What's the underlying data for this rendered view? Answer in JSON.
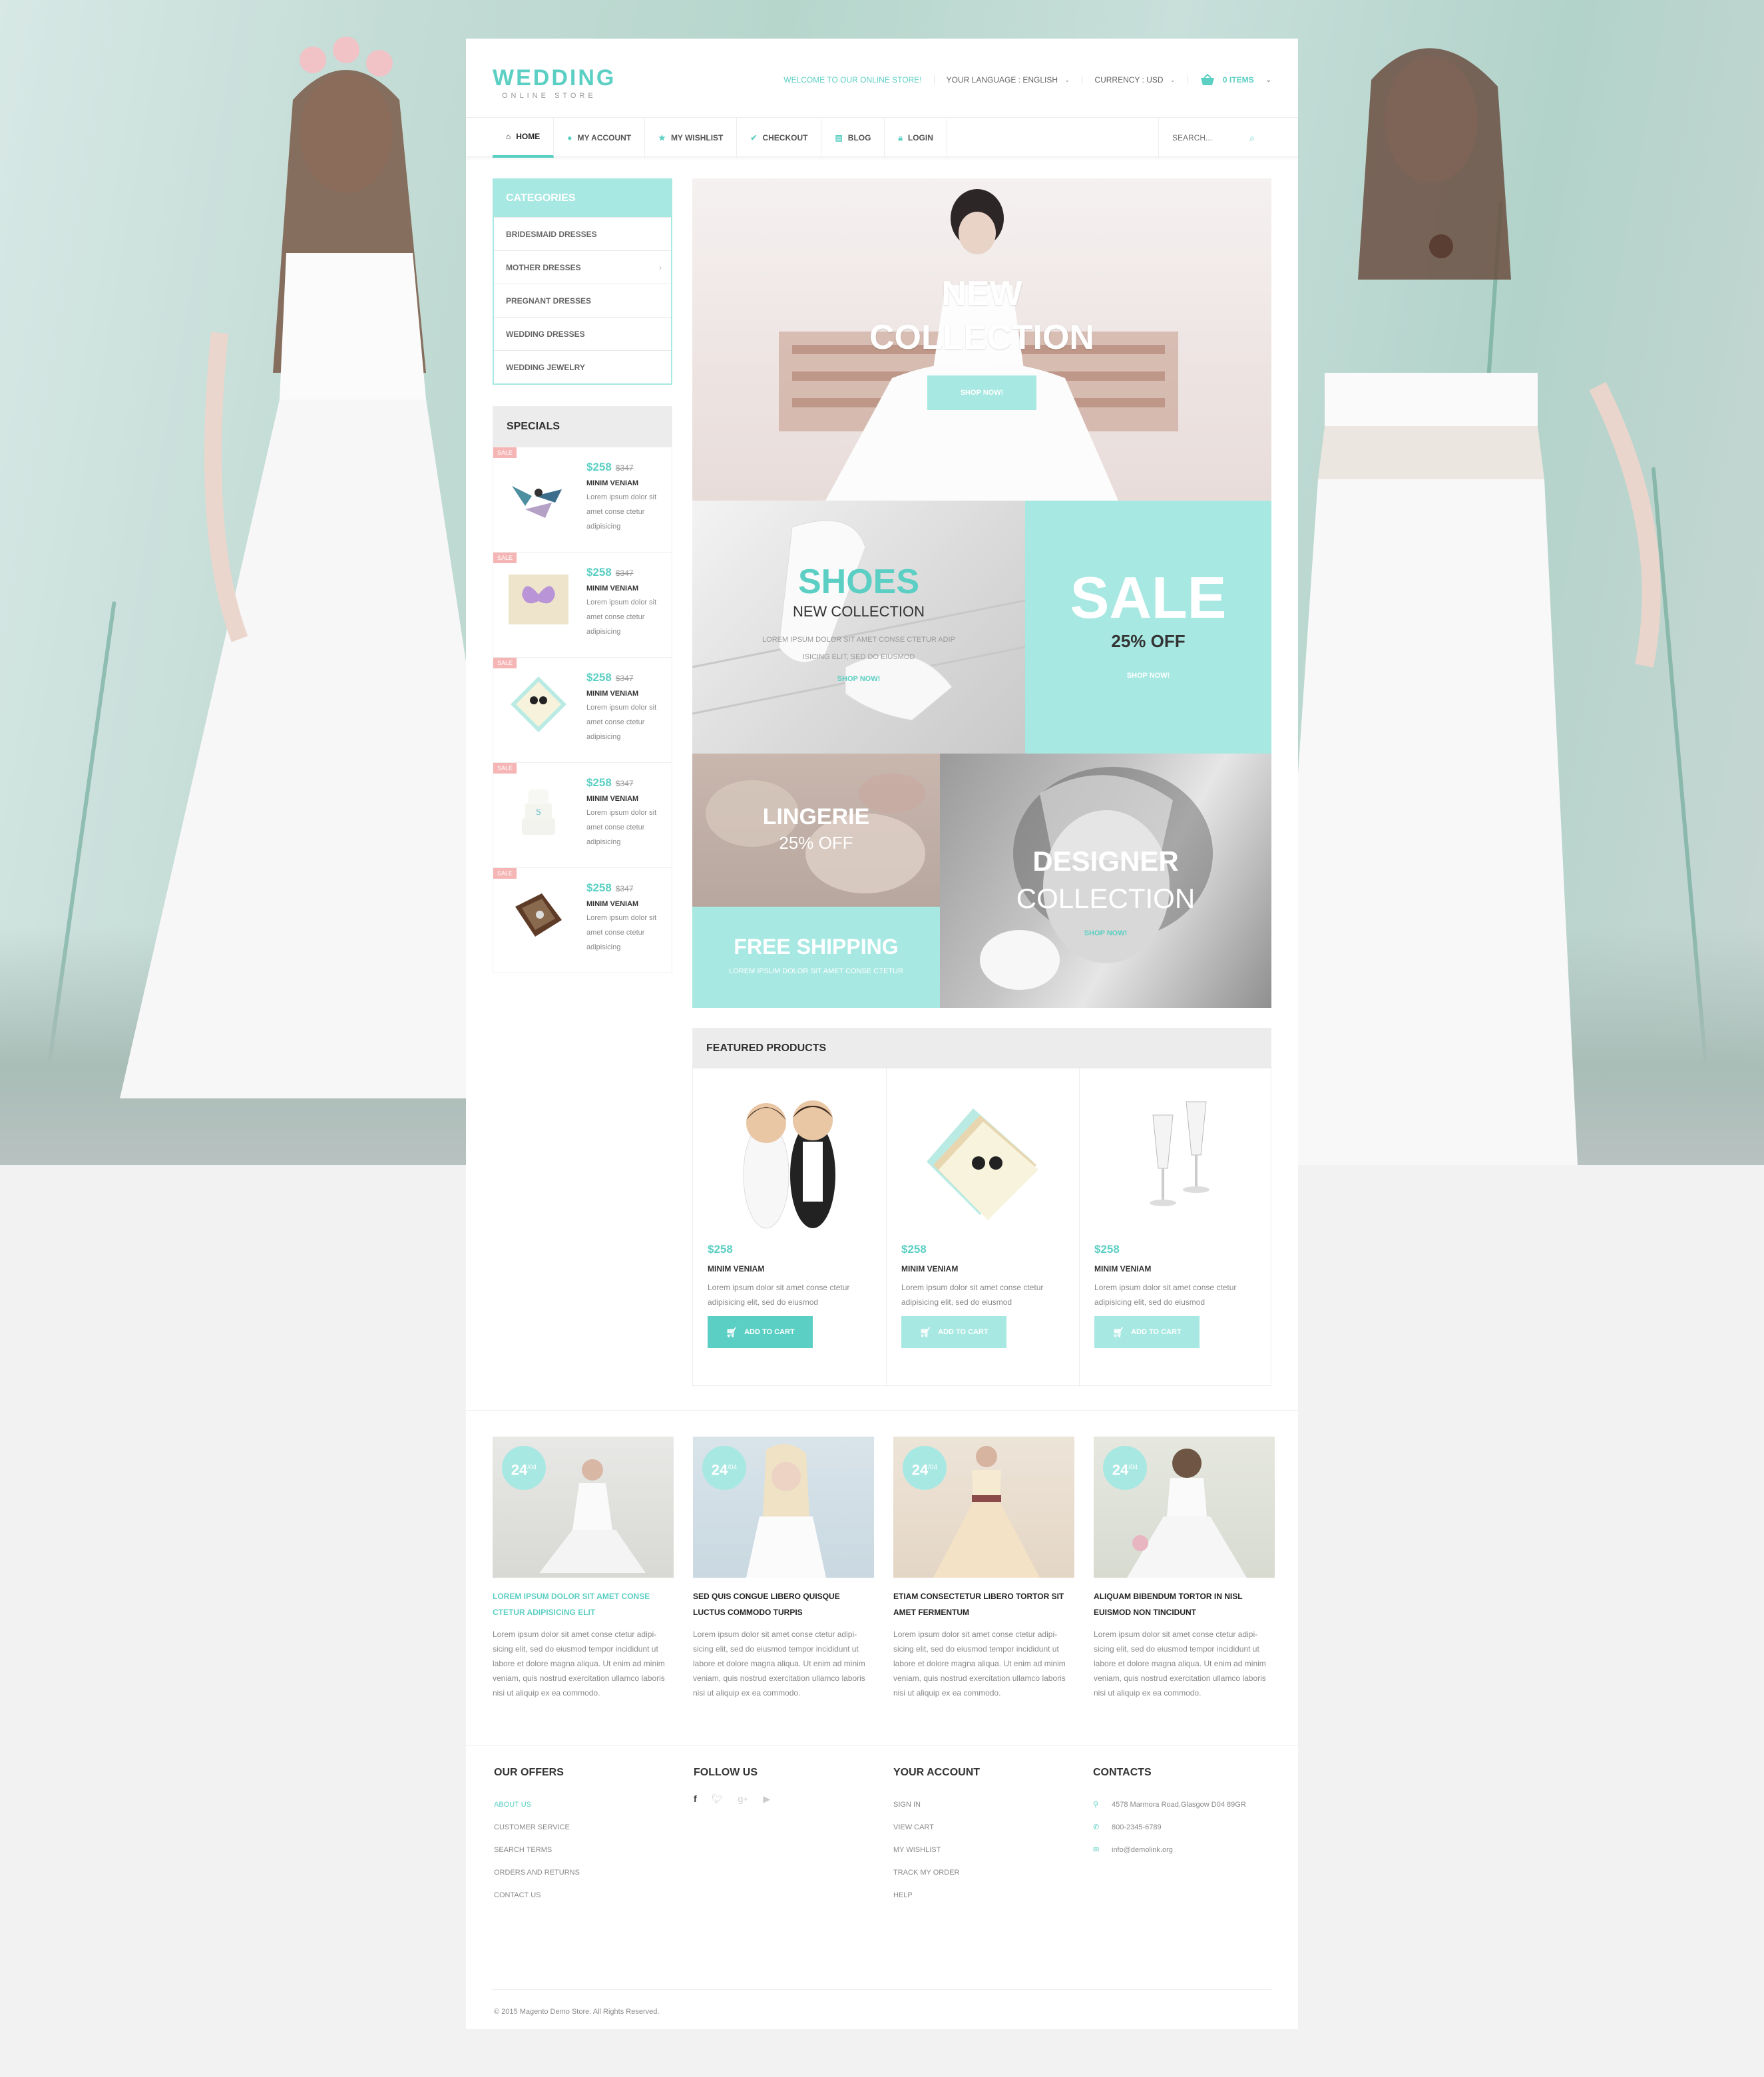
{
  "header": {
    "logo_title": "WEDDING",
    "logo_subtitle": "ONLINE STORE",
    "welcome": "WELCOME TO OUR ONLINE STORE!",
    "language": "YOUR LANGUAGE : ENGLISH",
    "currency": "CURRENCY : USD",
    "cart": "0 ITEMS"
  },
  "nav": {
    "items": [
      {
        "label": "HOME",
        "icon": "home-icon"
      },
      {
        "label": "MY ACCOUNT",
        "icon": "user-icon"
      },
      {
        "label": "MY WISHLIST",
        "icon": "star-icon"
      },
      {
        "label": "CHECKOUT",
        "icon": "check-circle-icon"
      },
      {
        "label": "BLOG",
        "icon": "book-icon"
      },
      {
        "label": "LOGIN",
        "icon": "lock-icon"
      }
    ],
    "search_placeholder": "SEARCH..."
  },
  "sidebar": {
    "categories_title": "CATEGORIES",
    "categories": [
      "BRIDESMAID DRESSES",
      "MOTHER DRESSES",
      "PREGNANT DRESSES",
      "WEDDING DRESSES",
      "WEDDING JEWELRY"
    ],
    "specials_title": "SPECIALS",
    "specials": [
      {
        "badge": "SALE",
        "price": "$258",
        "old_price": "$347",
        "name": "MINIM VENIAM",
        "desc": "Lorem ipsum dolor sit amet conse ctetur adipisicing"
      },
      {
        "badge": "SALE",
        "price": "$258",
        "old_price": "$347",
        "name": "MINIM VENIAM",
        "desc": "Lorem ipsum dolor sit amet conse ctetur adipisicing"
      },
      {
        "badge": "SALE",
        "price": "$258",
        "old_price": "$347",
        "name": "MINIM VENIAM",
        "desc": "Lorem ipsum dolor sit amet conse ctetur adipisicing"
      },
      {
        "badge": "SALE",
        "price": "$258",
        "old_price": "$347",
        "name": "MINIM VENIAM",
        "desc": "Lorem ipsum dolor sit amet conse ctetur adipisicing"
      },
      {
        "badge": "SALE",
        "price": "$258",
        "old_price": "$347",
        "name": "MINIM VENIAM",
        "desc": "Lorem ipsum dolor sit amet conse ctetur adipisicing"
      }
    ]
  },
  "banners": {
    "new_line1": "NEW",
    "new_line2": "COLLECTION",
    "shop_now": "SHOP NOW!",
    "shoes_title": "SHOES",
    "shoes_sub": "NEW COLLECTION",
    "shoes_text_line1": "LOREM IPSUM DOLOR SIT AMET CONSE CTETUR ADIP",
    "shoes_text_line2": "ISICING ELIT, SED DO EIUSMOD",
    "sale_title": "SALE",
    "sale_sub": "25% OFF",
    "lingerie_title": "LINGERIE",
    "lingerie_sub": "25% OFF",
    "shipping_title": "FREE SHIPPING",
    "shipping_text": "LOREM IPSUM DOLOR SIT AMET CONSE CTETUR",
    "designer_title": "DESIGNER",
    "designer_sub": "COLLECTION"
  },
  "featured": {
    "title": "FEATURED PRODUCTS",
    "products": [
      {
        "price": "$258",
        "name": "MINIM VENIAM",
        "desc": "Lorem ipsum dolor sit amet conse ctetur adipisicing elit, sed do eiusmod",
        "button": "ADD TO CART"
      },
      {
        "price": "$258",
        "name": "MINIM VENIAM",
        "desc": "Lorem ipsum dolor sit amet conse ctetur adipisicing elit, sed do eiusmod",
        "button": "ADD TO CART"
      },
      {
        "price": "$258",
        "name": "MINIM VENIAM",
        "desc": "Lorem ipsum dolor sit amet conse ctetur adipisicing elit, sed do eiusmod",
        "button": "ADD TO CART"
      }
    ]
  },
  "blog": [
    {
      "day": "24",
      "month": "/04",
      "title": "LOREM IPSUM DOLOR SIT AMET CONSE CTETUR ADIPISICING ELIT",
      "text": "Lorem ipsum dolor sit amet conse ctetur adipi-sicing elit, sed do eiusmod tempor incididunt ut labore et dolore magna aliqua. Ut enim ad minim veniam, quis nostrud exercitation ullamco laboris nisi ut aliquip ex ea commodo."
    },
    {
      "day": "24",
      "month": "/04",
      "title": "SED QUIS CONGUE LIBERO QUISQUE LUCTUS COMMODO TURPIS",
      "text": "Lorem ipsum dolor sit amet conse ctetur adipi-sicing elit, sed do eiusmod tempor incididunt ut labore et dolore magna aliqua. Ut enim ad minim veniam, quis nostrud exercitation ullamco laboris nisi ut aliquip ex ea commodo."
    },
    {
      "day": "24",
      "month": "/04",
      "title": "ETIAM CONSECTETUR LIBERO TORTOR SIT AMET FERMENTUM",
      "text": "Lorem ipsum dolor sit amet conse ctetur adipi-sicing elit, sed do eiusmod tempor incididunt ut labore et dolore magna aliqua. Ut enim ad minim veniam, quis nostrud exercitation ullamco laboris nisi ut aliquip ex ea commodo."
    },
    {
      "day": "24",
      "month": "/04",
      "title": "ALIQUAM BIBENDUM TORTOR IN NISL EUISMOD NON TINCIDUNT",
      "text": "Lorem ipsum dolor sit amet conse ctetur adipi-sicing elit, sed do eiusmod tempor incididunt ut labore et dolore magna aliqua. Ut enim ad minim veniam, quis nostrud exercitation ullamco laboris nisi ut aliquip ex ea commodo."
    }
  ],
  "footer": {
    "offers_title": "OUR OFFERS",
    "offers": [
      "ABOUT US",
      "CUSTOMER SERVICE",
      "SEARCH TERMS",
      "ORDERS AND RETURNS",
      "CONTACT US"
    ],
    "follow_title": "FOLLOW US",
    "account_title": "YOUR ACCOUNT",
    "account": [
      "SIGN IN",
      "VIEW CART",
      "MY WISHLIST",
      "TRACK MY ORDER",
      "HELP"
    ],
    "contacts_title": "CONTACTS",
    "address": "4578 Marmora Road,Glasgow D04 89GR",
    "phone": "800-2345-6789",
    "email": "info@demolink.org",
    "copyright": "© 2015 Magento Demo Store. All Rights Reserved."
  },
  "colors": {
    "accent": "#5bcfc3",
    "accent_light": "#a8e8e2",
    "sale_badge": "#f6b5b5"
  }
}
